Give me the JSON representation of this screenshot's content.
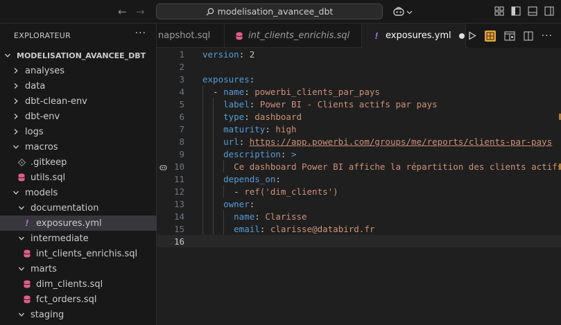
{
  "titlebar": {
    "search_text": "modelisation_avancee_dbt"
  },
  "sidebar": {
    "header": "EXPLORATEUR",
    "more": "···",
    "root": "MODELISATION_AVANCEE_DBT",
    "items": [
      {
        "label": "analyses",
        "type": "folder",
        "expanded": false,
        "depth": 1
      },
      {
        "label": "data",
        "type": "folder",
        "expanded": false,
        "depth": 1
      },
      {
        "label": "dbt-clean-env",
        "type": "folder",
        "expanded": false,
        "depth": 1
      },
      {
        "label": "dbt-env",
        "type": "folder",
        "expanded": false,
        "depth": 1
      },
      {
        "label": "logs",
        "type": "folder",
        "expanded": false,
        "depth": 1
      },
      {
        "label": "macros",
        "type": "folder",
        "expanded": true,
        "depth": 1
      },
      {
        "label": ".gitkeep",
        "type": "gitkeep",
        "depth": 2
      },
      {
        "label": "utils.sql",
        "type": "sql",
        "depth": 2
      },
      {
        "label": "models",
        "type": "folder",
        "expanded": true,
        "depth": 1
      },
      {
        "label": "documentation",
        "type": "folder",
        "expanded": true,
        "depth": 2
      },
      {
        "label": "exposures.yml",
        "type": "yml",
        "depth": 3,
        "selected": true
      },
      {
        "label": "intermediate",
        "type": "folder",
        "expanded": true,
        "depth": 2
      },
      {
        "label": "int_clients_enrichis.sql",
        "type": "sql",
        "depth": 3
      },
      {
        "label": "marts",
        "type": "folder",
        "expanded": true,
        "depth": 2
      },
      {
        "label": "dim_clients.sql",
        "type": "sql",
        "depth": 3
      },
      {
        "label": "fct_orders.sql",
        "type": "sql",
        "depth": 3
      },
      {
        "label": "staging",
        "type": "folder",
        "expanded": true,
        "depth": 2
      }
    ]
  },
  "tabs": [
    {
      "label": "napshot.sql",
      "type": "plain",
      "active": false
    },
    {
      "label": "int_clients_enrichis.sql",
      "type": "sql",
      "active": false,
      "italic": true
    },
    {
      "label": "exposures.yml",
      "type": "yml",
      "active": true,
      "italic": false,
      "dirty": true
    }
  ],
  "editor": {
    "lines": [
      {
        "num": "1",
        "tokens": [
          [
            "k",
            "version"
          ],
          [
            "p",
            ": "
          ],
          [
            "n",
            "2"
          ]
        ]
      },
      {
        "num": "2",
        "tokens": []
      },
      {
        "num": "3",
        "tokens": [
          [
            "k",
            "exposures"
          ],
          [
            "p",
            ":"
          ]
        ]
      },
      {
        "num": "4",
        "tokens": [
          [
            "p",
            "  - "
          ],
          [
            "k",
            "name"
          ],
          [
            "p",
            ": "
          ],
          [
            "s",
            "powerbi_clients_par_pays"
          ]
        ]
      },
      {
        "num": "5",
        "tokens": [
          [
            "p",
            "    "
          ],
          [
            "k",
            "label"
          ],
          [
            "p",
            ": "
          ],
          [
            "s",
            "Power BI - Clients actifs par pays"
          ]
        ]
      },
      {
        "num": "6",
        "tokens": [
          [
            "p",
            "    "
          ],
          [
            "k",
            "type"
          ],
          [
            "p",
            ": "
          ],
          [
            "s",
            "dashboard"
          ]
        ]
      },
      {
        "num": "7",
        "tokens": [
          [
            "p",
            "    "
          ],
          [
            "k",
            "maturity"
          ],
          [
            "p",
            ": "
          ],
          [
            "s",
            "high"
          ]
        ]
      },
      {
        "num": "8",
        "tokens": [
          [
            "p",
            "    "
          ],
          [
            "k",
            "url"
          ],
          [
            "p",
            ": "
          ],
          [
            "u",
            "https://app.powerbi.com/groups/me/reports/clients-par-pays"
          ]
        ]
      },
      {
        "num": "9",
        "tokens": [
          [
            "p",
            "    "
          ],
          [
            "k",
            "description"
          ],
          [
            "p",
            ": "
          ],
          [
            "k",
            ">"
          ]
        ]
      },
      {
        "num": "10",
        "tokens": [
          [
            "p",
            "      "
          ],
          [
            "s",
            "Ce dashboard Power BI affiche la répartition des clients actifs pa"
          ]
        ]
      },
      {
        "num": "11",
        "tokens": [
          [
            "p",
            "    "
          ],
          [
            "k",
            "depends_on"
          ],
          [
            "p",
            ":"
          ]
        ]
      },
      {
        "num": "12",
        "tokens": [
          [
            "p",
            "      - "
          ],
          [
            "s",
            "ref('dim_clients')"
          ]
        ]
      },
      {
        "num": "13",
        "tokens": [
          [
            "p",
            "    "
          ],
          [
            "k",
            "owner"
          ],
          [
            "p",
            ":"
          ]
        ]
      },
      {
        "num": "14",
        "tokens": [
          [
            "p",
            "      "
          ],
          [
            "k",
            "name"
          ],
          [
            "p",
            ": "
          ],
          [
            "s",
            "Clarisse"
          ]
        ]
      },
      {
        "num": "15",
        "tokens": [
          [
            "p",
            "      "
          ],
          [
            "k",
            "email"
          ],
          [
            "p",
            ": "
          ],
          [
            "s",
            "clarisse@databird.fr"
          ]
        ]
      },
      {
        "num": "16",
        "tokens": []
      }
    ],
    "current_line": 16
  }
}
